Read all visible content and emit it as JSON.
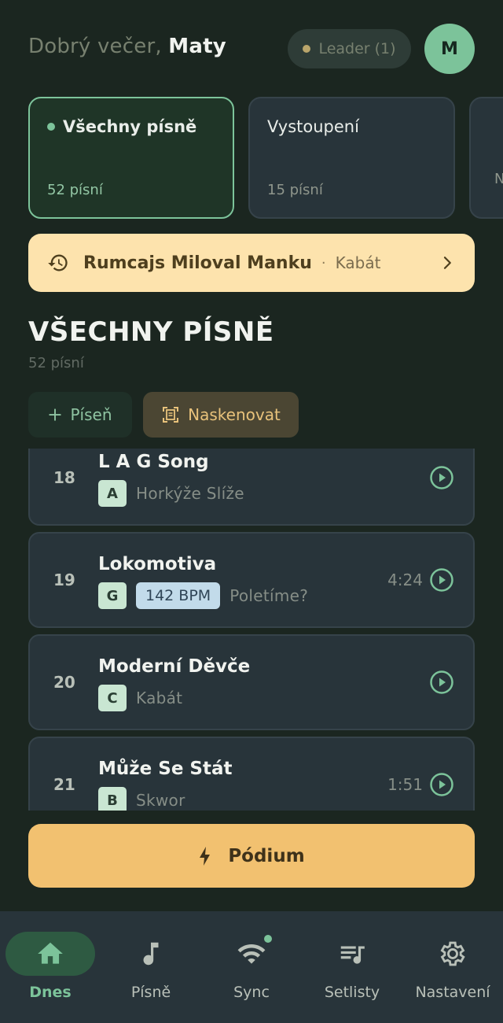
{
  "header": {
    "greeting_prefix": "Dobrý večer,",
    "user_name": "Maty",
    "leader_label": "Leader (1)",
    "avatar_initial": "M"
  },
  "categories": [
    {
      "title": "Všechny písně",
      "count": "52 písní",
      "active": true
    },
    {
      "title": "Vystoupení",
      "count": "15 písní",
      "active": false
    },
    {
      "title": "",
      "count": "N",
      "active": false
    }
  ],
  "recent": {
    "icon": "history-icon",
    "title": "Rumcajs Miloval Manku",
    "separator": "·",
    "artist": "Kabát"
  },
  "section": {
    "title": "VŠECHNY PÍSNĚ",
    "subtitle": "52 písní"
  },
  "actions": {
    "add_label": "Píseň",
    "add_icon": "plus-icon",
    "scan_label": "Naskenovat",
    "scan_icon": "scan-icon"
  },
  "songs": [
    {
      "number": "18",
      "title": "L A G Song",
      "key": "A",
      "bpm": "",
      "artist": "Horkýže Slíže",
      "duration": ""
    },
    {
      "number": "19",
      "title": "Lokomotiva",
      "key": "G",
      "bpm": "142 BPM",
      "artist": "Poletíme?",
      "duration": "4:24"
    },
    {
      "number": "20",
      "title": "Moderní Děvče",
      "key": "C",
      "bpm": "",
      "artist": "Kabát",
      "duration": ""
    },
    {
      "number": "21",
      "title": "Může Se Stát",
      "key": "B",
      "bpm": "",
      "artist": "Skwor",
      "duration": "1:51"
    }
  ],
  "podium": {
    "label": "Pódium",
    "icon": "bolt-icon"
  },
  "nav": [
    {
      "label": "Dnes",
      "icon": "home-icon",
      "active": true
    },
    {
      "label": "Písně",
      "icon": "music-note-icon",
      "active": false
    },
    {
      "label": "Sync",
      "icon": "wifi-icon",
      "active": false
    },
    {
      "label": "Setlisty",
      "icon": "playlist-icon",
      "active": false
    },
    {
      "label": "Nastavení",
      "icon": "gear-icon",
      "active": false
    }
  ],
  "colors": {
    "background": "#1b2620",
    "accent_green": "#7cc39a",
    "card": "#28343a",
    "banner": "#fde3ad",
    "podium": "#f2c170"
  }
}
